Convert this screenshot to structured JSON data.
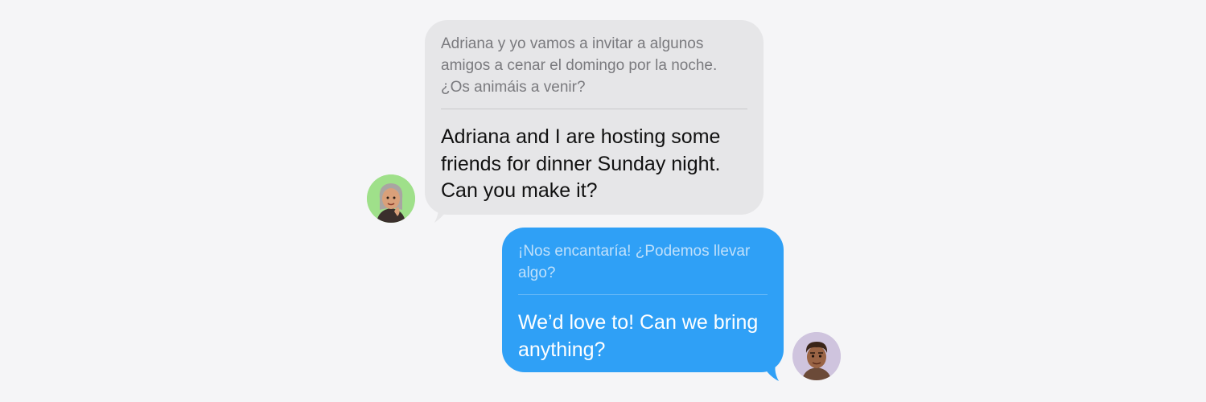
{
  "conversation": {
    "messages": [
      {
        "sender": "contact",
        "original": "Adriana y yo vamos a invitar a algunos amigos a cenar el domingo por la noche. ¿Os animáis a venir?",
        "translation": "Adriana and I are hosting some friends for dinner Sunday night. Can you make it?"
      },
      {
        "sender": "me",
        "original": "¡Nos encantaría! ¿Podemos llevar algo?",
        "translation": "We’d love to! Can we bring anything?"
      }
    ]
  },
  "colors": {
    "background": "#f5f5f7",
    "received_bubble": "#e6e6e8",
    "sent_bubble": "#2fa0f6",
    "contact_avatar_bg": "#9fe08a",
    "my_avatar_bg": "#cfc4de"
  },
  "icons": {
    "contact_avatar": "memoji-woman-avatar",
    "my_avatar": "memoji-man-avatar"
  }
}
